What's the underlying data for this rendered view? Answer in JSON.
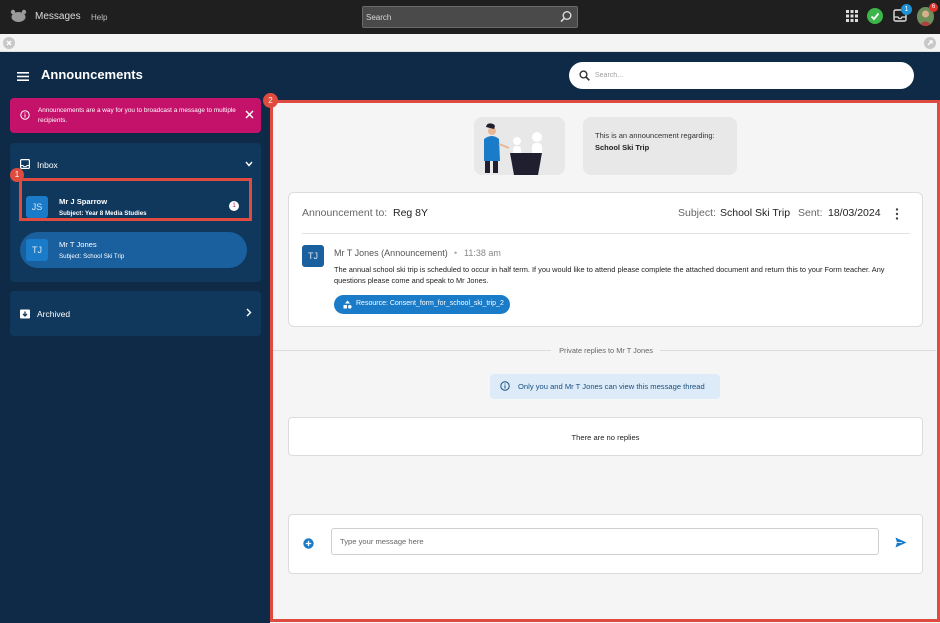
{
  "topbar": {
    "app_name": "Messages",
    "help": "Help",
    "search_placeholder": "Search",
    "notif_count": "1",
    "alert_count": "6"
  },
  "header": {
    "title": "Announcements",
    "search_placeholder": "Search..."
  },
  "alert": {
    "text": "Announcements are a way for you to broadcast a message to multiple recipients."
  },
  "inbox": {
    "title": "Inbox",
    "items": [
      {
        "initials": "JS",
        "name": "Mr J Sparrow",
        "subject": "Subject: Year 8 Media Studies",
        "unread": "1"
      },
      {
        "initials": "TJ",
        "name": "Mr T Jones",
        "subject": "Subject: School Ski Trip"
      }
    ]
  },
  "archived": {
    "title": "Archived"
  },
  "annotations": {
    "one": "1",
    "two": "2"
  },
  "about": {
    "line1": "This is an announcement regarding:",
    "line2": "School Ski Trip"
  },
  "announcement": {
    "to_label": "Announcement to:",
    "to_value": "Reg 8Y",
    "subject_label": "Subject:",
    "subject_value": "School Ski Trip",
    "sent_label": "Sent:",
    "sent_value": "18/03/2024",
    "sender_initials": "TJ",
    "sender": "Mr T Jones (Announcement)",
    "separator": "•",
    "time": "11:38 am",
    "body": "The annual school ski trip is scheduled to occur in half term. If you would like to attend please complete the attached document and return this to your Form teacher. Any questions please come and speak to Mr Jones.",
    "resource": "Resource: Consent_form_for_school_ski_trip_2"
  },
  "replies": {
    "divider_label": "Private replies to Mr T Jones",
    "privacy_note": "Only you and Mr T Jones can view this message thread",
    "empty": "There are no replies"
  },
  "composer": {
    "placeholder": "Type your message here"
  },
  "colors": {
    "app_bg": "#0e2a47",
    "alert": "#c4126b",
    "accent": "#1a7bc9",
    "highlight": "#e04b3f"
  }
}
